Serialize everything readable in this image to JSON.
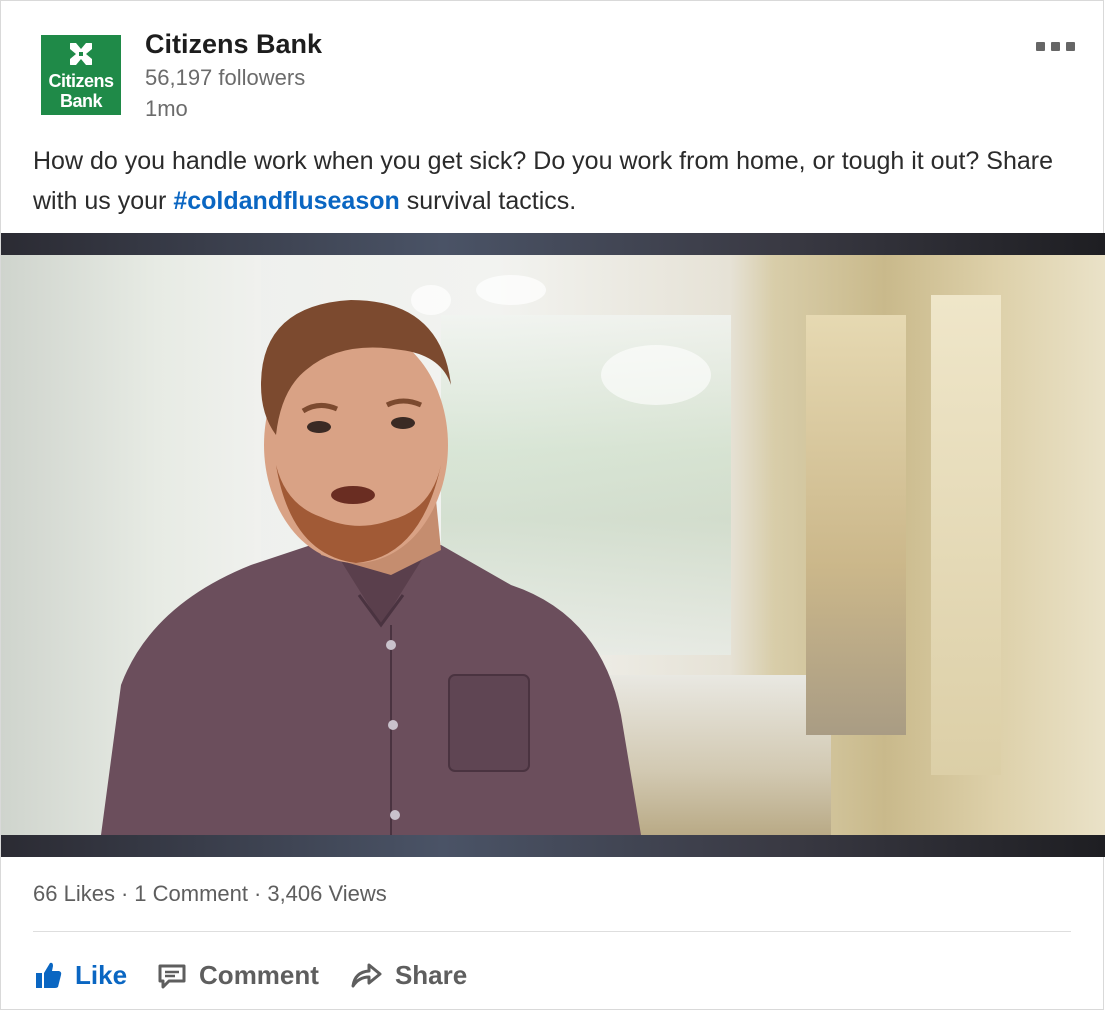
{
  "post": {
    "company": {
      "name": "Citizens Bank",
      "followers": "56,197 followers",
      "time_ago": "1mo",
      "logo": {
        "line1": "Citizens",
        "line2": "Bank",
        "color": "#1f8a48"
      }
    },
    "text_before": "How do you handle work when you get sick? Do you work from home, or tough it out? Share with us your ",
    "hashtag": "#coldandfluseason",
    "text_after": " survival tactics.",
    "more_icon": "ellipsis-icon"
  },
  "stats": {
    "likes": "66 Likes",
    "comments": "1 Comment",
    "views": "3,406 Views"
  },
  "actions": {
    "like": "Like",
    "comment": "Comment",
    "share": "Share"
  },
  "colors": {
    "accent": "#0a66c2",
    "brand": "#1f8a48"
  }
}
